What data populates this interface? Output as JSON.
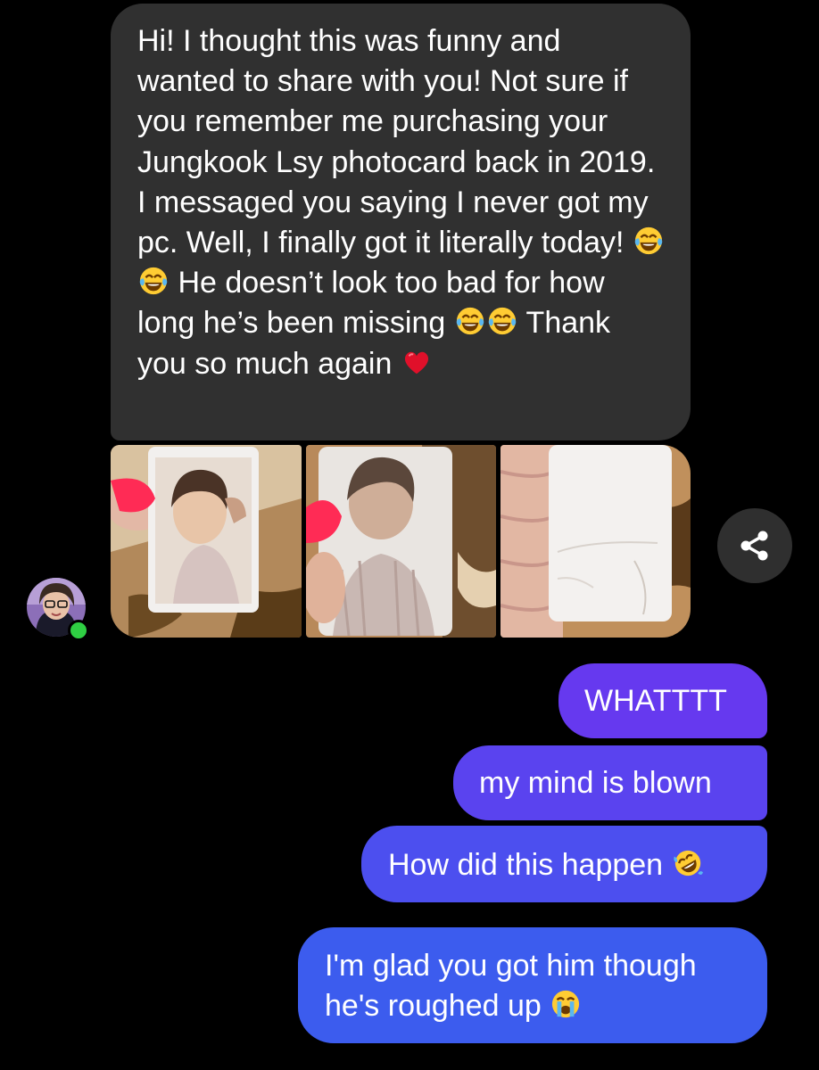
{
  "incoming_message": {
    "segments": [
      "Hi! I thought this was funny and wanted to share with you! Not sure if you remember me purchasing your Jungkook Lsy photocard back in 2019. I messaged you saying I never got my pc. Well, I finally got it literally today! ",
      " He doesn’t look too bad for how long he’s been missing ",
      " Thank you so much again "
    ],
    "emojis": [
      "tears-of-joy-emoji",
      "tears-of-joy-emoji",
      "tears-of-joy-emoji",
      "tears-of-joy-emoji",
      "red-heart-emoji"
    ]
  },
  "photos": [
    {
      "name": "photocard-front-photo"
    },
    {
      "name": "photocard-front-angle-photo"
    },
    {
      "name": "photocard-back-photo"
    }
  ],
  "share_button": {
    "icon": "share-icon"
  },
  "contact": {
    "avatar": "contact-avatar",
    "status": "online",
    "status_color": "#2fcf43"
  },
  "outgoing_messages": [
    {
      "text": "WHATTTT",
      "color": "#6639ef"
    },
    {
      "text": "my mind is blown",
      "color": "#5a43ef"
    },
    {
      "text": "How did this happen ",
      "emoji": "rolling-on-floor-laughing-emoji",
      "color": "#4c4fef"
    },
    {
      "line1": "I'm glad you got him though",
      "line2": "he's roughed up ",
      "emoji": "loudly-crying-emoji",
      "color": "#3c5cee"
    }
  ],
  "colors": {
    "background": "#000000",
    "incoming_bubble": "#303030",
    "text": "#ffffff"
  }
}
